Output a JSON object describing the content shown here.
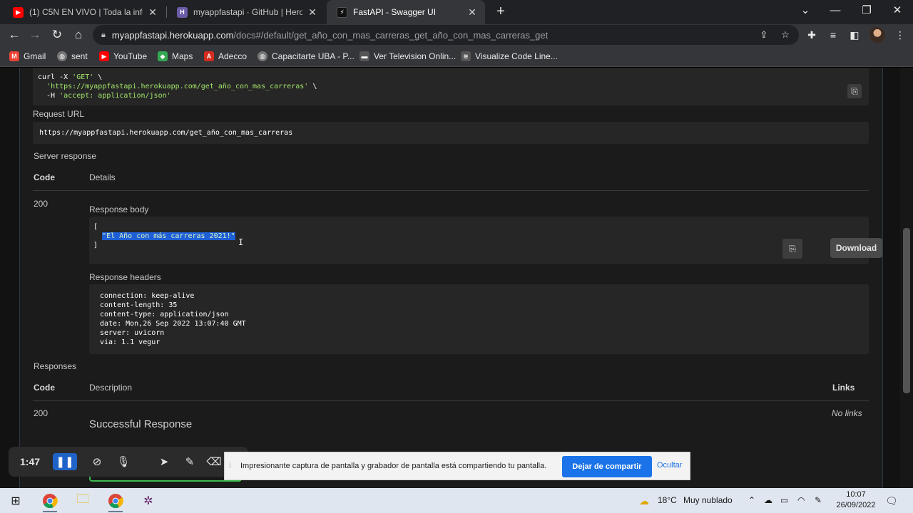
{
  "browser": {
    "tabs": [
      {
        "title": "(1) C5N EN VIVO | Toda la inform",
        "icon": "youtube-icon",
        "color": "#ff0000",
        "glyph": "▶"
      },
      {
        "title": "myappfastapi · GitHub | Heroku",
        "icon": "heroku-icon",
        "color": "#6b5ba8",
        "glyph": "H"
      },
      {
        "title": "FastAPI - Swagger UI",
        "icon": "swagger-icon",
        "color": "#111111",
        "glyph": "⚡"
      }
    ],
    "new_tab": "+",
    "window_controls": {
      "minimize": "—",
      "maximize": "❐",
      "close": "✕",
      "list": "⌄"
    },
    "url_host": "myappfastapi.herokuapp.com",
    "url_path": "/docs#/default/get_año_con_mas_carreras_get_año_con_mas_carreras_get",
    "bookmarks": [
      {
        "label": "Gmail",
        "icon": "gmail-icon",
        "color": "#ea4335",
        "glyph": "M"
      },
      {
        "label": "sent",
        "icon": "globe-icon",
        "color": "#777777",
        "glyph": "◍"
      },
      {
        "label": "YouTube",
        "icon": "youtube-icon",
        "color": "#ff0000",
        "glyph": "▶"
      },
      {
        "label": "Maps",
        "icon": "maps-icon",
        "color": "#34a853",
        "glyph": "◆"
      },
      {
        "label": "Adecco",
        "icon": "adecco-icon",
        "color": "#d62b1f",
        "glyph": "A"
      },
      {
        "label": "Capacitarte UBA - P...",
        "icon": "globe-icon",
        "color": "#777777",
        "glyph": "◍"
      },
      {
        "label": "Ver Television Onlin...",
        "icon": "tv-icon",
        "color": "#555555",
        "glyph": "▬"
      },
      {
        "label": "Visualize Code Line...",
        "icon": "code-icon",
        "color": "#555555",
        "glyph": "≋"
      }
    ]
  },
  "swagger": {
    "curl_lines": [
      "curl -X 'GET' \\",
      "'https://myappfastapi.herokuapp.com/get_año_con_mas_carreras' \\",
      "-H 'accept: application/json'"
    ],
    "request_url_label": "Request URL",
    "request_url": "https://myappfastapi.herokuapp.com/get_año_con_mas_carreras",
    "server_response_label": "Server response",
    "code_header": "Code",
    "details_header": "Details",
    "status_code": "200",
    "response_body_label": "Response body",
    "response_body_open": "[",
    "response_body_value": "\"El Año con más carreras 2021!\"",
    "response_body_close": "]",
    "download_label": "Download",
    "response_headers_label": "Response headers",
    "response_headers": [
      "connection: keep-alive",
      "content-length: 35",
      "content-type: application/json",
      "date: Mon,26 Sep 2022 13:07:40 GMT",
      "server: uvicorn",
      "via: 1.1 vegur"
    ],
    "responses_label": "Responses",
    "description_header": "Description",
    "links_header": "Links",
    "response_code": "200",
    "response_description": "Successful Response",
    "links_value": "No links"
  },
  "recorder": {
    "time": "1:47",
    "share_message": "Impresionante captura de pantalla y grabador de pantalla está compartiendo tu pantalla.",
    "stop_label": "Dejar de compartir",
    "hide_label": "Ocultar"
  },
  "taskbar": {
    "temperature": "18°C",
    "weather": "Muy nublado",
    "time": "10:07",
    "date": "26/09/2022"
  },
  "colors": {
    "selection": "#1f5fd6",
    "share_button": "#1a73e8",
    "string": "#a0e46a"
  }
}
